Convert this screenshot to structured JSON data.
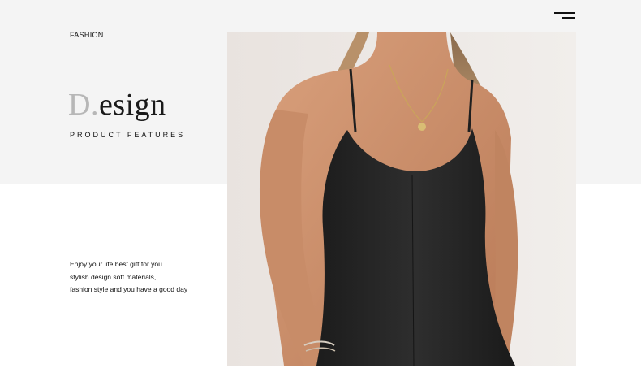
{
  "header": {
    "category": "FASHION",
    "menu_icon": "hamburger-menu-icon"
  },
  "hero": {
    "title_initial": "D.",
    "title_rest": "esign",
    "subtitle": "PRODUCT FEATURES"
  },
  "description": {
    "lines": [
      "Enjoy your life,best gift for you",
      "stylish design soft materials,",
      "fashion style and you have a good day"
    ]
  },
  "colors": {
    "top_band": "#f4f4f4",
    "title_initial": "#b7b7b7",
    "dress": "#262626"
  }
}
